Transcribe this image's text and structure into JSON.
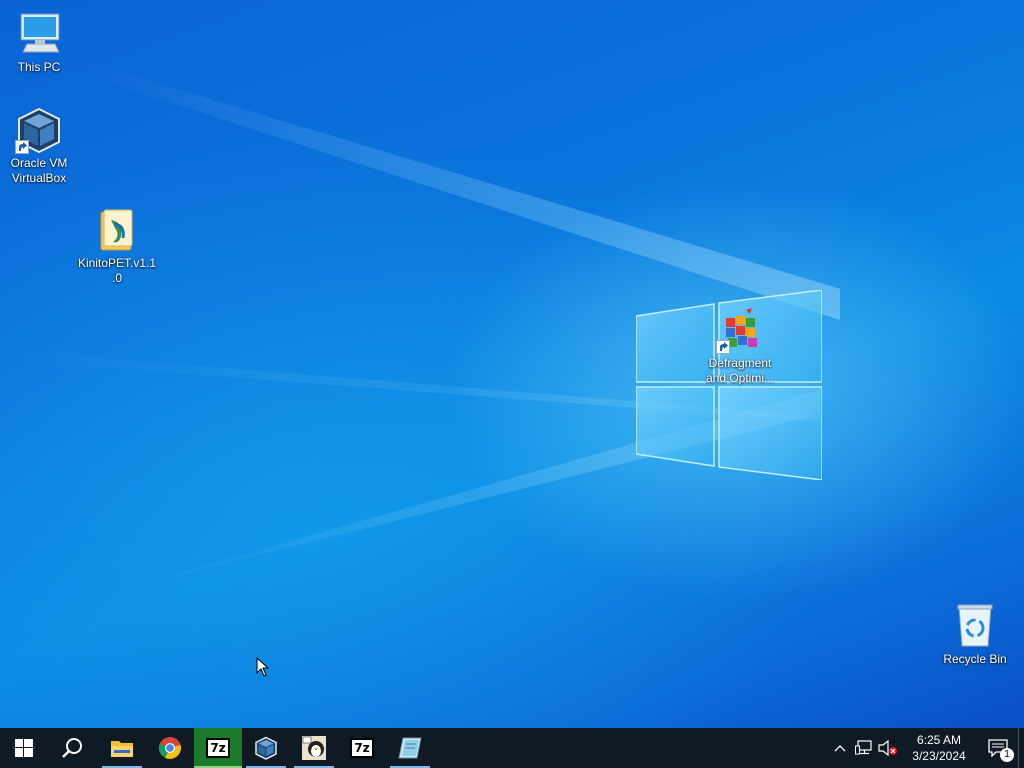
{
  "desktop": {
    "icons": [
      {
        "label": "This PC",
        "icon": "computer-icon"
      },
      {
        "label": "Oracle VM VirtualBox",
        "icon": "virtualbox-icon"
      },
      {
        "label": "KinitoPET.v1.1.0",
        "icon": "folder-icon"
      },
      {
        "label": "Defragment and Optimi...",
        "icon": "defragment-icon"
      },
      {
        "label": "Recycle Bin",
        "icon": "recycle-bin-icon"
      }
    ]
  },
  "taskbar": {
    "apps": [
      {
        "name": "Start",
        "icon": "windows-start-icon"
      },
      {
        "name": "Search",
        "icon": "search-icon"
      },
      {
        "name": "File Explorer",
        "icon": "file-explorer-icon"
      },
      {
        "name": "Google Chrome",
        "icon": "chrome-icon"
      },
      {
        "name": "7-Zip",
        "icon": "seven-zip-icon",
        "text": "7z"
      },
      {
        "name": "Oracle VM VirtualBox",
        "icon": "virtualbox-icon"
      },
      {
        "name": "Tool",
        "icon": "penguin-app-icon"
      },
      {
        "name": "7-Zip",
        "icon": "seven-zip-icon",
        "text": "7z"
      },
      {
        "name": "Notepad",
        "icon": "notepad-icon"
      }
    ],
    "tray": {
      "time": "6:25 AM",
      "date": "3/23/2024",
      "notification_count": "1",
      "icons": [
        "chevron-up-icon",
        "network-icon",
        "volume-muted-icon",
        "action-center-icon"
      ]
    }
  },
  "colors": {
    "taskbar": "#101a24",
    "accent": "#76b9ed",
    "focused_app": "#1e7a2b"
  }
}
